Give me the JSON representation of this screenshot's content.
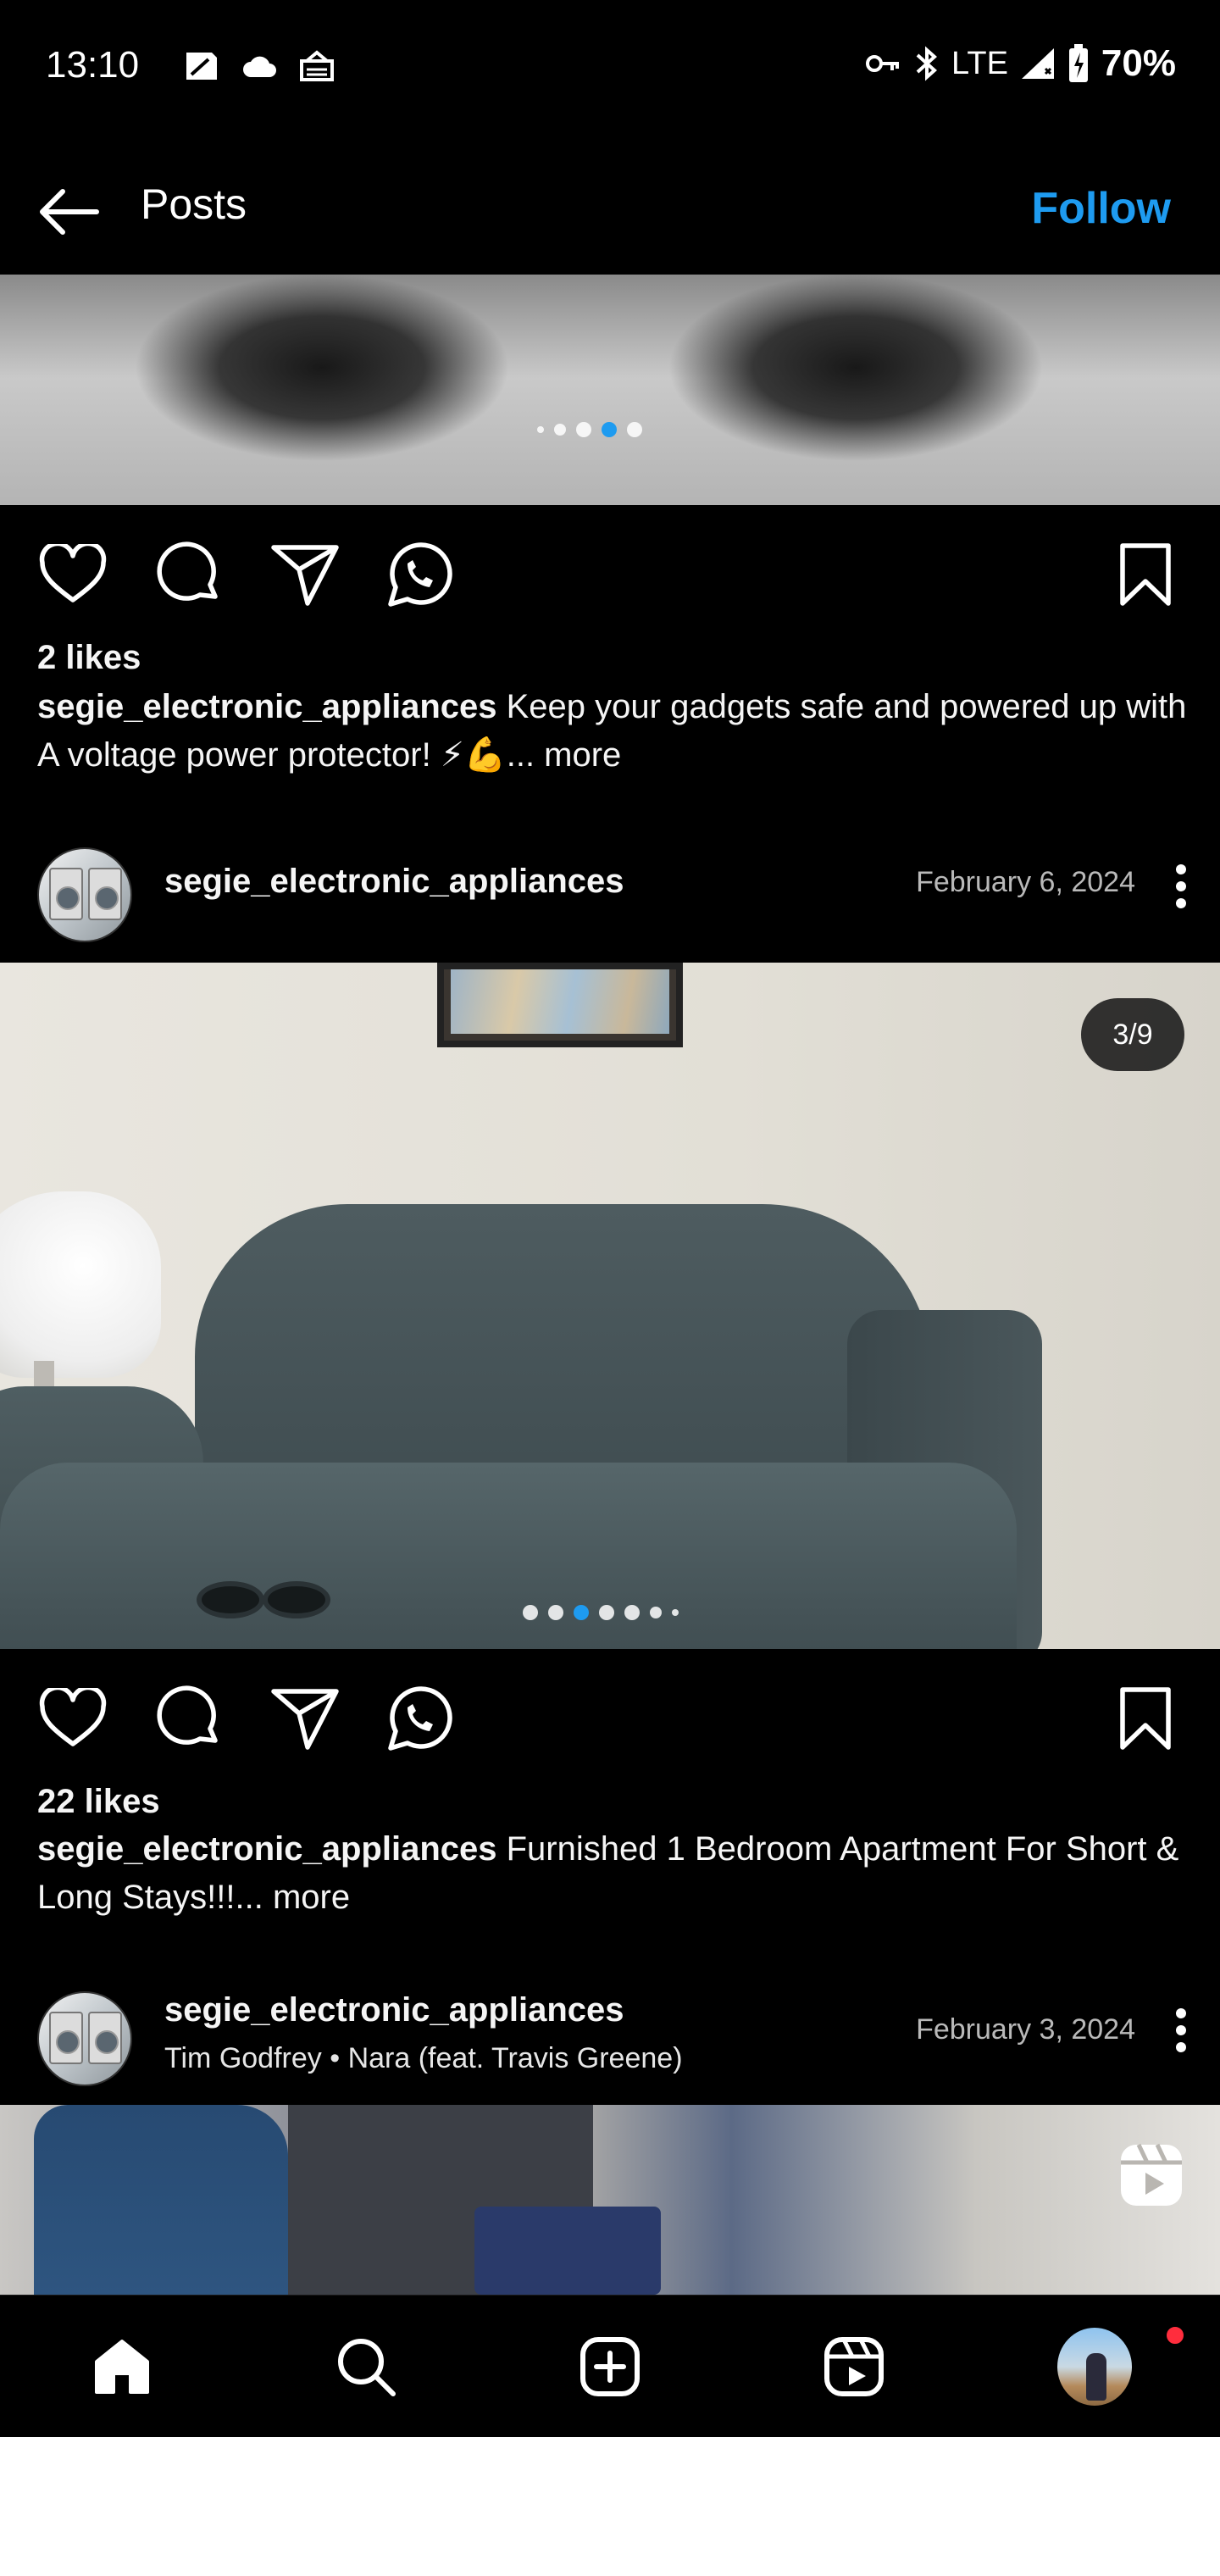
{
  "status_bar": {
    "time": "13:10",
    "network": "LTE",
    "battery": "70%",
    "left_icons": [
      "sim-card-icon",
      "cloud-icon",
      "inbox-tray-icon"
    ],
    "right_icons": [
      "vpn-key-icon",
      "bluetooth-icon",
      "signal-icon",
      "battery-charging-icon"
    ]
  },
  "header": {
    "title": "Posts",
    "follow_label": "Follow"
  },
  "colors": {
    "accent": "#1e9bf0",
    "background": "#000000",
    "notification": "#ff2d3d"
  },
  "posts": [
    {
      "carousel_dots": 5,
      "carousel_active_index": 3,
      "likes": "2 likes",
      "caption_user": "segie_electronic_appliances",
      "caption_text": "Keep your gadgets safe and powered up with A voltage power protector! ⚡💪",
      "more_label": "... more"
    },
    {
      "username": "segie_electronic_appliances",
      "date": "February 6, 2024",
      "counter": "3/9",
      "carousel_dots": 7,
      "carousel_active_index": 2,
      "likes": "22 likes",
      "caption_user": "segie_electronic_appliances",
      "caption_text": "Furnished 1 Bedroom Apartment For Short & Long Stays!!!",
      "more_label": "... more"
    },
    {
      "username": "segie_electronic_appliances",
      "audio_artist": "Tim Godfrey",
      "audio_track": "Nara (feat. Travis Greene)",
      "date": "February 3, 2024",
      "media_type_icon": "reels-icon"
    }
  ],
  "bottom_nav": [
    "home-icon",
    "search-icon",
    "create-icon",
    "reels-icon",
    "profile-avatar"
  ]
}
